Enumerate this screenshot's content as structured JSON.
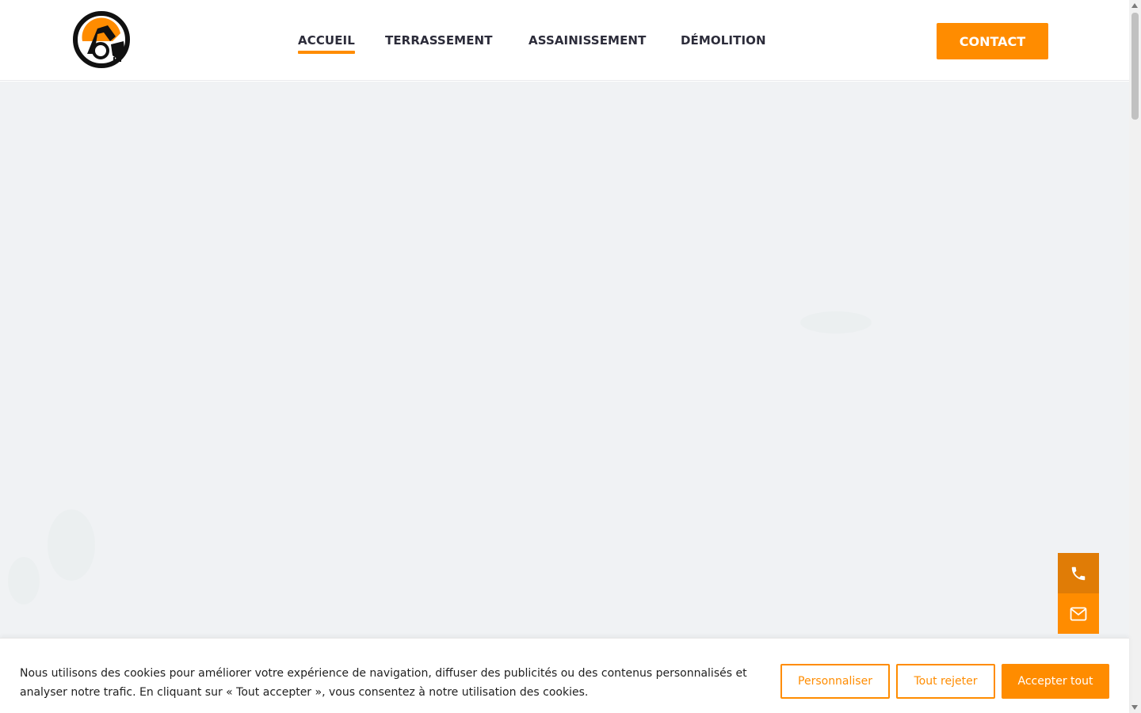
{
  "header": {
    "logo_icon": "excavator-logo-icon",
    "nav": [
      {
        "label": "ACCUEIL",
        "active": true
      },
      {
        "label": "TERRASSEMENT",
        "active": false
      },
      {
        "label": "ASSAINISSEMENT",
        "active": false
      },
      {
        "label": "DÉMOLITION",
        "active": false
      }
    ],
    "contact_label": "CONTACT"
  },
  "floating": {
    "phone_icon": "phone-icon",
    "mail_icon": "mail-icon"
  },
  "cookie_banner": {
    "text": "Nous utilisons des cookies pour améliorer votre expérience de navigation, diffuser des publicités ou des contenus personnalisés et analyser notre trafic. En cliquant sur « Tout accepter », vous consentez à notre utilisation des cookies.",
    "customize_label": "Personnaliser",
    "reject_label": "Tout rejeter",
    "accept_label": "Accepter tout"
  },
  "colors": {
    "accent": "#ff8c00",
    "nav_text": "#2c2c3a",
    "hero_bg": "#f0f2f4"
  }
}
